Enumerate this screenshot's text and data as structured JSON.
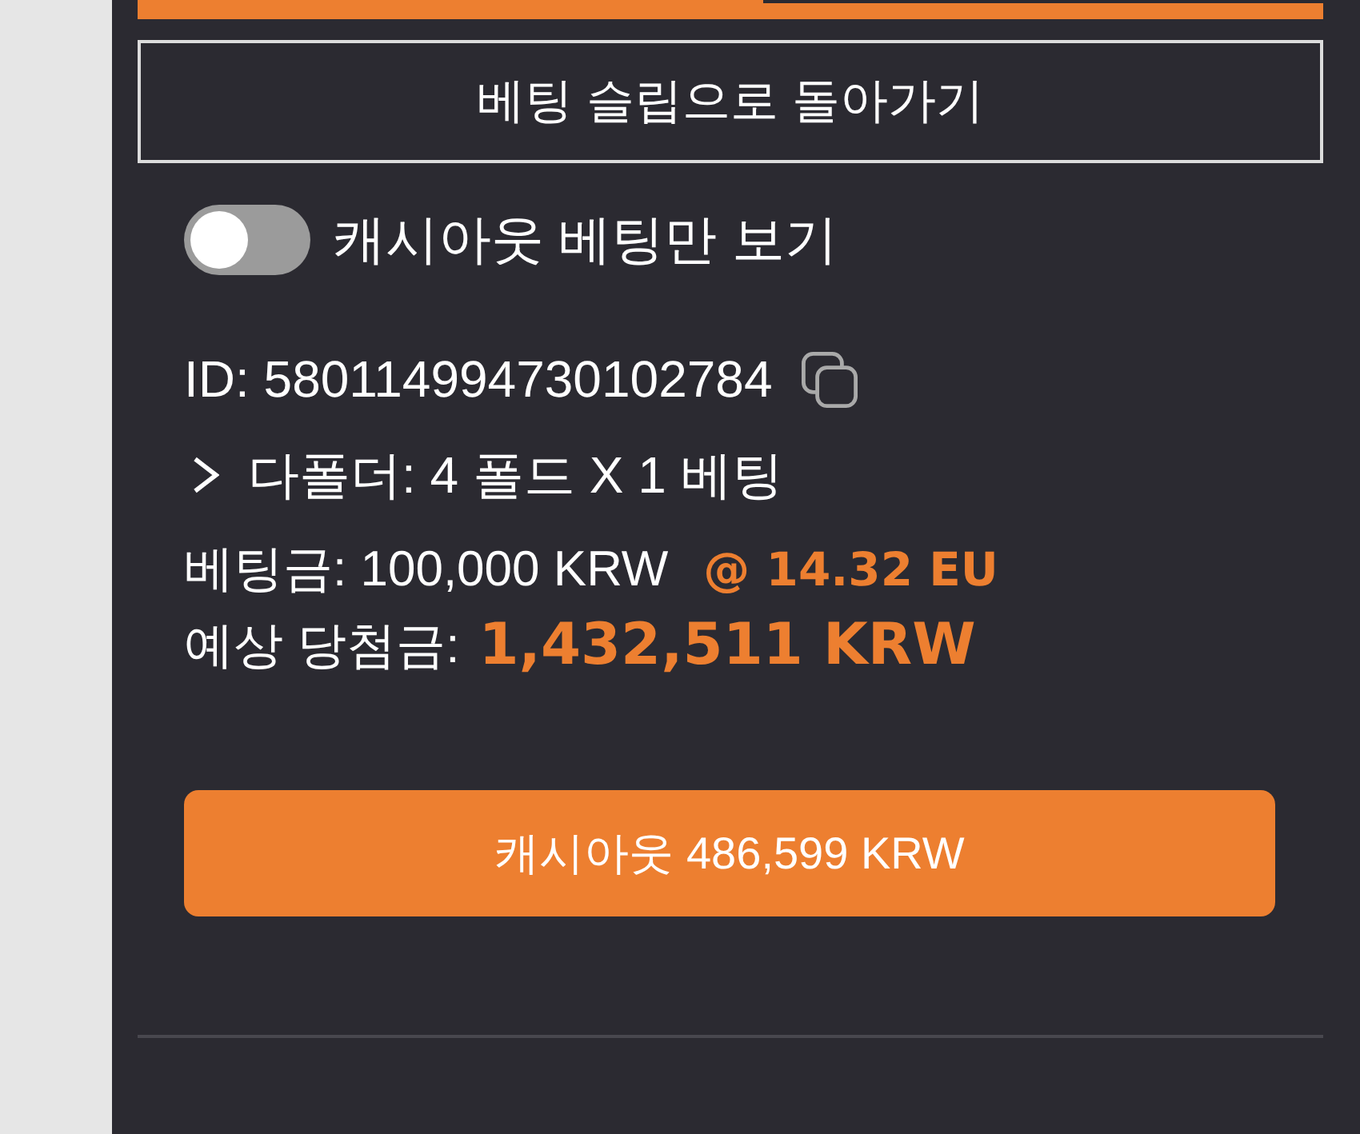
{
  "tabs": [
    {
      "selected": true
    },
    {
      "selected": false
    }
  ],
  "back_button": {
    "label": "베팅 슬립으로 돌아가기"
  },
  "cashout_filter": {
    "label": "캐시아웃 베팅만 보기",
    "on": false
  },
  "bet": {
    "id_label": "ID: 580114994730102784",
    "summary": {
      "label": "다폴더: 4 폴드 X 1 베팅",
      "expanded": false
    },
    "stake": {
      "label": "베팅금: 100,000 KRW",
      "odds": "@ 14.32 EU"
    },
    "potential_win": {
      "label": "예상 당첨금:",
      "amount": "1,432,511 KRW"
    }
  },
  "cashout_button": {
    "label": "캐시아웃 486,599 KRW"
  }
}
